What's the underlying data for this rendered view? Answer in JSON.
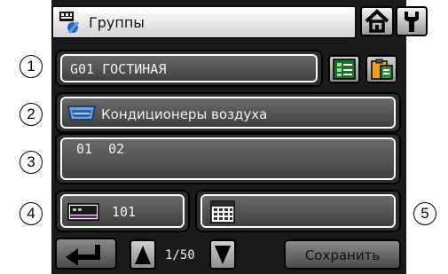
{
  "title": {
    "text": "Группы",
    "icon": "groups-icon"
  },
  "top_buttons": [
    {
      "icon": "home-icon"
    },
    {
      "icon": "settings-icon"
    }
  ],
  "callouts": [
    "1",
    "2",
    "3",
    "4",
    "5"
  ],
  "group_name": {
    "value": "G01 ГОСТИНАЯ"
  },
  "device_type": {
    "label": "Кондиционеры воздуха",
    "icon": "air-conditioner-icon"
  },
  "addresses": {
    "value": "01  02"
  },
  "remote_controller": {
    "value": "101",
    "icon": "remote-controller-icon"
  },
  "schedule": {
    "value": "",
    "icon": "calendar-icon"
  },
  "footer": {
    "page": "1/50",
    "save_label": "Сохранить"
  },
  "colors": {
    "panel": "#2e2e2e",
    "field": "#4a4a4a",
    "frame": "#1b1b1b"
  }
}
